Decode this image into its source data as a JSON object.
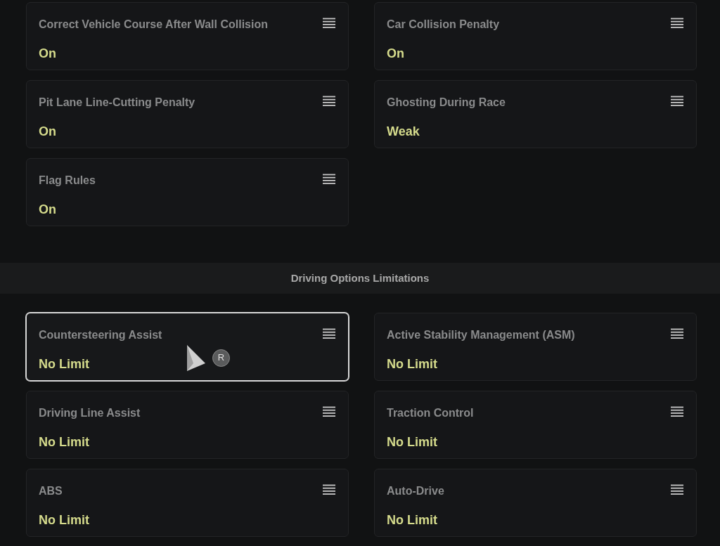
{
  "sections": [
    {
      "cards": [
        {
          "title": "Correct Vehicle Course After Wall Collision",
          "value": "On",
          "selected": false
        },
        {
          "title": "Car Collision Penalty",
          "value": "On",
          "selected": false
        },
        {
          "title": "Pit Lane Line-Cutting Penalty",
          "value": "On",
          "selected": false
        },
        {
          "title": "Ghosting During Race",
          "value": "Weak",
          "selected": false
        },
        {
          "title": "Flag Rules",
          "value": "On",
          "selected": false
        }
      ]
    },
    {
      "heading": "Driving Options Limitations",
      "cards": [
        {
          "title": "Countersteering Assist",
          "value": "No Limit",
          "selected": true
        },
        {
          "title": "Active Stability Management (ASM)",
          "value": "No Limit",
          "selected": false
        },
        {
          "title": "Driving Line Assist",
          "value": "No Limit",
          "selected": false
        },
        {
          "title": "Traction Control",
          "value": "No Limit",
          "selected": false
        },
        {
          "title": "ABS",
          "value": "No Limit",
          "selected": false
        },
        {
          "title": "Auto-Drive",
          "value": "No Limit",
          "selected": false
        }
      ]
    }
  ],
  "cursor": {
    "badge": "R"
  }
}
